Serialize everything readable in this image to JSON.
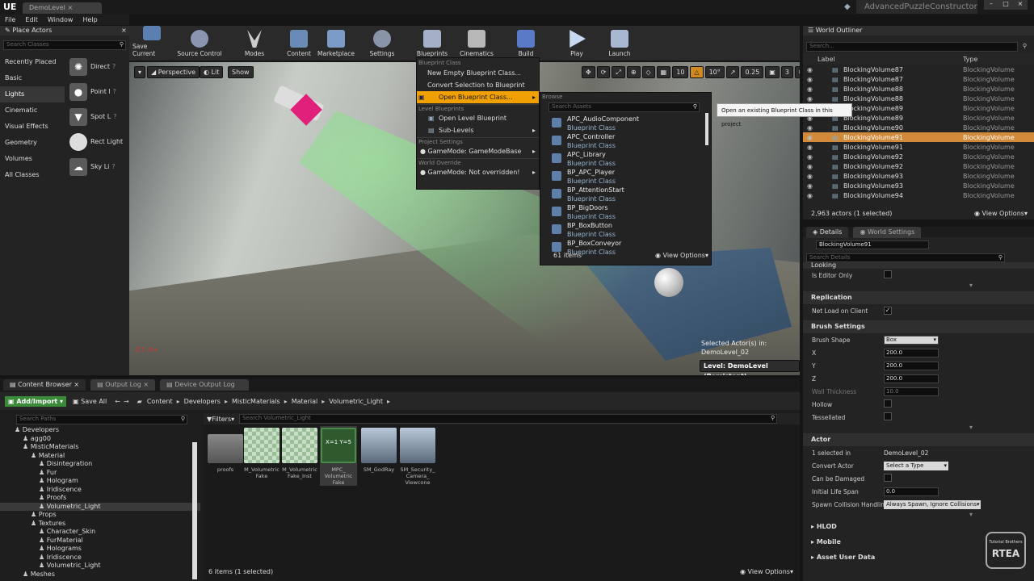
{
  "window": {
    "tab_title": "DemoLevel",
    "project": "AdvancedPuzzleConstructor",
    "logo": "UE"
  },
  "menu": [
    "File",
    "Edit",
    "Window",
    "Help"
  ],
  "place_actors": {
    "title": "Place Actors",
    "search_placeholder": "Search Classes",
    "categories": [
      "Recently Placed",
      "Basic",
      "Lights",
      "Cinematic",
      "Visual Effects",
      "Geometry",
      "Volumes",
      "All Classes"
    ],
    "selected_category": "Lights",
    "items": [
      "Direct",
      "Point l",
      "Spot L",
      "Rect Light",
      "Sky Li"
    ]
  },
  "toolbar": {
    "buttons": [
      "Save Current",
      "Source Control",
      "Modes",
      "Content",
      "Marketplace",
      "Settings",
      "Blueprints",
      "Cinematics",
      "Build",
      "Play",
      "Launch"
    ]
  },
  "viewport": {
    "perspective": "Perspective",
    "lit": "Lit",
    "show": "Show",
    "grid_value": "10",
    "angle_value": "10°",
    "scale_value": "0.25",
    "camera_speed": "3",
    "selected_text_line1": "Selected Actor(s) in:",
    "selected_text_line2": "DemoLevel_02",
    "level_label": "Level:  DemoLevel (Persistent)"
  },
  "blueprint_menu": {
    "header_class": "Blueprint Class",
    "new_empty": "New Empty Blueprint Class...",
    "convert": "Convert Selection to Blueprint Class...",
    "open": "Open Blueprint Class...",
    "header_level": "Level Blueprints",
    "open_level": "Open Level Blueprint",
    "sub_levels": "Sub-Levels",
    "header_project": "Project Settings",
    "game_mode": "GameMode: GameModeBase",
    "header_world": "World Override",
    "world_game_mode": "GameMode: Not overridden!"
  },
  "browse": {
    "header": "Browse",
    "search_placeholder": "Search Assets",
    "items": [
      {
        "name": "APC_AudioComponent",
        "type": "Blueprint Class"
      },
      {
        "name": "APC_Controller",
        "type": "Blueprint Class"
      },
      {
        "name": "APC_Library",
        "type": "Blueprint Class"
      },
      {
        "name": "BP_APC_Player",
        "type": "Blueprint Class"
      },
      {
        "name": "BP_AttentionStart",
        "type": "Blueprint Class"
      },
      {
        "name": "BP_BigDoors",
        "type": "Blueprint Class"
      },
      {
        "name": "BP_BoxButton",
        "type": "Blueprint Class"
      },
      {
        "name": "BP_BoxConveyor",
        "type": "Blueprint Class"
      }
    ],
    "count": "61 items",
    "view_options": "View Options"
  },
  "tooltip": "Open an existing Blueprint Class in this project",
  "outliner": {
    "title": "World Outliner",
    "search_placeholder": "Search...",
    "col_label": "Label",
    "col_type": "Type",
    "rows": [
      {
        "label": "BlockingVolume87",
        "type": "BlockingVolume"
      },
      {
        "label": "BlockingVolume87",
        "type": "BlockingVolume"
      },
      {
        "label": "BlockingVolume88",
        "type": "BlockingVolume"
      },
      {
        "label": "BlockingVolume88",
        "type": "BlockingVolume"
      },
      {
        "label": "BlockingVolume89",
        "type": "BlockingVolume"
      },
      {
        "label": "BlockingVolume89",
        "type": "BlockingVolume"
      },
      {
        "label": "BlockingVolume90",
        "type": "BlockingVolume"
      },
      {
        "label": "BlockingVolume91",
        "type": "BlockingVolume"
      },
      {
        "label": "BlockingVolume91",
        "type": "BlockingVolume"
      },
      {
        "label": "BlockingVolume92",
        "type": "BlockingVolume"
      },
      {
        "label": "BlockingVolume92",
        "type": "BlockingVolume"
      },
      {
        "label": "BlockingVolume93",
        "type": "BlockingVolume"
      },
      {
        "label": "BlockingVolume93",
        "type": "BlockingVolume"
      },
      {
        "label": "BlockingVolume94",
        "type": "BlockingVolume"
      }
    ],
    "selected_row": 7,
    "status": "2,963 actors (1 selected)",
    "view_options": "View Options"
  },
  "details": {
    "tab_details": "Details",
    "tab_world": "World Settings",
    "actor_name": "BlockingVolume91",
    "search_placeholder": "Search Details",
    "cut_section": "Looking",
    "is_editor_only": "Is Editor Only",
    "replication": "Replication",
    "net_load": "Net Load on Client",
    "brush_settings": "Brush Settings",
    "brush_shape_label": "Brush Shape",
    "brush_shape": "Box",
    "x_label": "X",
    "x": "200.0",
    "y_label": "Y",
    "y": "200.0",
    "z_label": "Z",
    "z": "200.0",
    "wall_label": "Wall Thickness",
    "wall": "10.0",
    "hollow": "Hollow",
    "tessellated": "Tessellated",
    "actor": "Actor",
    "selected_in_label": "1 selected in",
    "selected_in": "DemoLevel_02",
    "convert_label": "Convert Actor",
    "convert": "Select a Type",
    "damaged": "Can be Damaged",
    "life_label": "Initial Life Span",
    "life": "0.0",
    "spawn_label": "Spawn Collision Handling",
    "spawn": "Always Spawn, Ignore Collisions",
    "hlod": "HLOD",
    "mobile": "Mobile",
    "asset_user": "Asset User Data",
    "watermark_line1": "Tutorial Brothers",
    "watermark_line2": "RTEA"
  },
  "content_browser": {
    "tabs": [
      "Content Browser",
      "Output Log",
      "Device Output Log"
    ],
    "add_import": "Add/Import",
    "save_all": "Save All",
    "path": [
      "Content",
      "Developers",
      "MisticMaterials",
      "Material",
      "Volumetric_Light"
    ],
    "search_paths": "Search Paths",
    "filters": "Filters",
    "search_assets": "Search Volumetric_Light",
    "tree": [
      {
        "label": "Developers",
        "indent": 1
      },
      {
        "label": "agg00",
        "indent": 2
      },
      {
        "label": "MisticMaterials",
        "indent": 2
      },
      {
        "label": "Material",
        "indent": 3
      },
      {
        "label": "Disintegration",
        "indent": 4
      },
      {
        "label": "Fur",
        "indent": 4
      },
      {
        "label": "Hologram",
        "indent": 4
      },
      {
        "label": "Iridiscence",
        "indent": 4
      },
      {
        "label": "Proofs",
        "indent": 4
      },
      {
        "label": "Volumetric_Light",
        "indent": 4
      },
      {
        "label": "Props",
        "indent": 3
      },
      {
        "label": "Textures",
        "indent": 3
      },
      {
        "label": "Character_Skin",
        "indent": 4
      },
      {
        "label": "FurMaterial",
        "indent": 4
      },
      {
        "label": "Holograms",
        "indent": 4
      },
      {
        "label": "Iridiscence",
        "indent": 4
      },
      {
        "label": "Volumetric_Light",
        "indent": 4
      },
      {
        "label": "Meshes",
        "indent": 2
      }
    ],
    "selected_tree": 9,
    "assets": [
      {
        "name": "proofs"
      },
      {
        "name": "M_Volumetric Fake"
      },
      {
        "name": "M_Volumetric Fake_Inst"
      },
      {
        "name": "MPC_ Volumetric Fake",
        "badge": "X=1 Y=5"
      },
      {
        "name": "SM_GodRay"
      },
      {
        "name": "SM_Security_ Camera_ Viewcone"
      }
    ],
    "status": "6 items (1 selected)",
    "view_options": "View Options"
  },
  "colors": {
    "highlight": "#f0a000",
    "selection": "#d08a3a",
    "accent_green": "#3a8a3a"
  }
}
